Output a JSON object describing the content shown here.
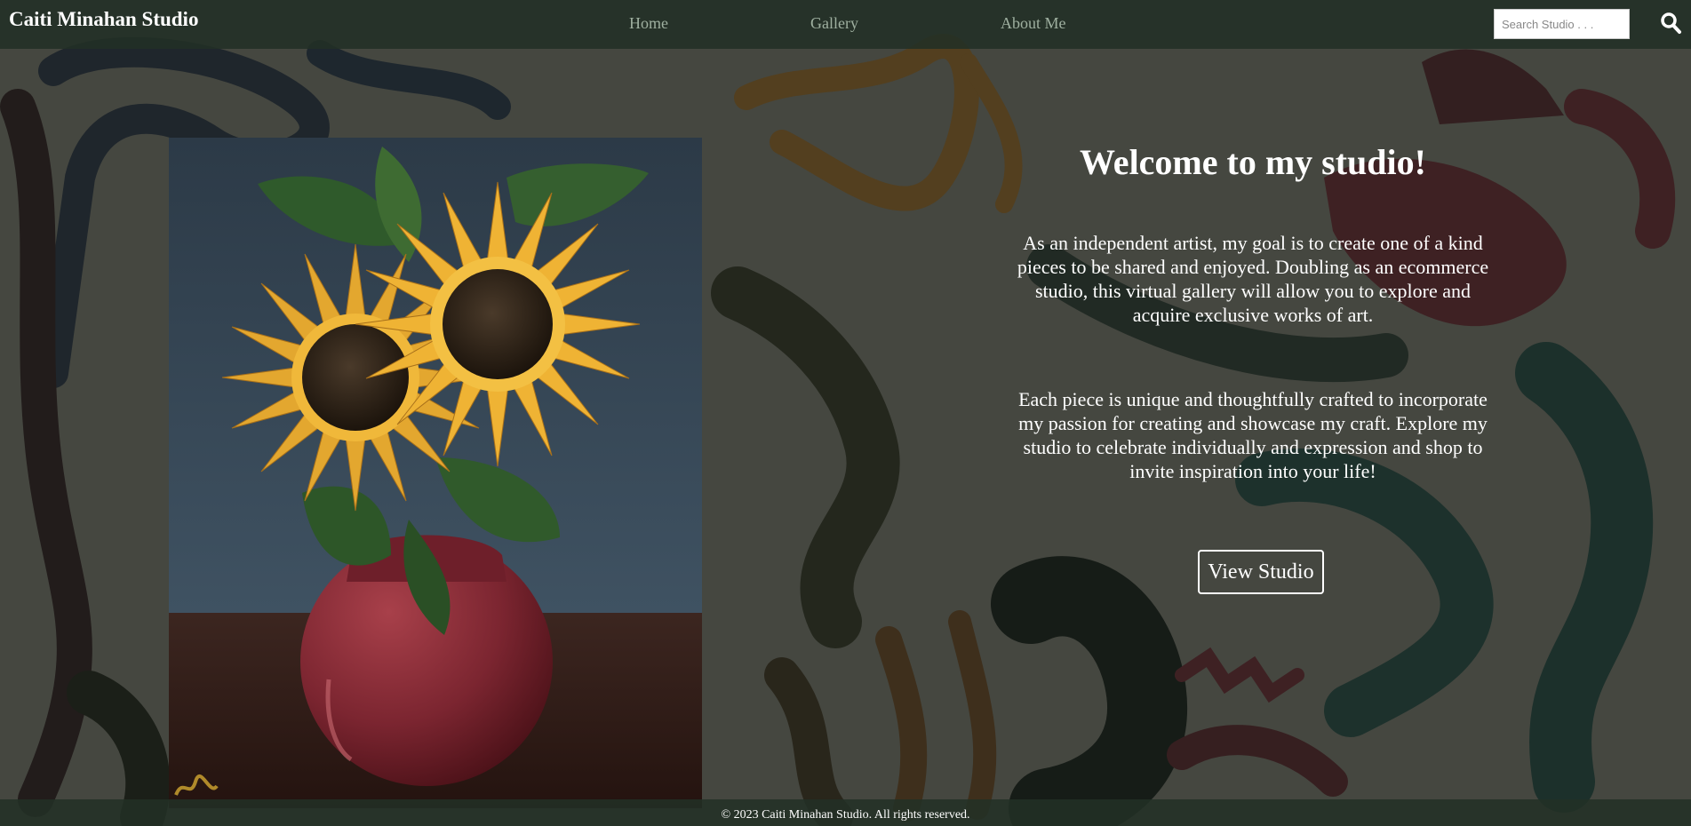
{
  "header": {
    "brand": "Caiti Minahan Studio",
    "nav": [
      {
        "label": "Home"
      },
      {
        "label": "Gallery"
      },
      {
        "label": "About Me"
      }
    ],
    "search": {
      "placeholder": "Search Studio . . .",
      "value": "",
      "icon": "search-icon"
    }
  },
  "hero": {
    "title": "Welcome to my studio!",
    "paragraph_1": "As an independent artist, my goal is to create one of a kind pieces to be shared and enjoyed. Doubling as an ecommerce studio, this virtual gallery will allow you to explore and acquire exclusive works of art.",
    "paragraph_2": "Each piece is unique and thoughtfully crafted to incorporate my passion for creating and showcase my craft. Explore my studio to celebrate individually and expression and shop to invite inspiration into your life!",
    "button_label": "View Studio"
  },
  "painting": {
    "subject": "sunflowers-in-red-vase-painting"
  },
  "footer": {
    "text": "© 2023 Caiti Minahan Studio. All rights reserved."
  },
  "colors": {
    "header_bg": "#223026",
    "nav_text": "#9fb0a0",
    "text": "#ffffff"
  }
}
